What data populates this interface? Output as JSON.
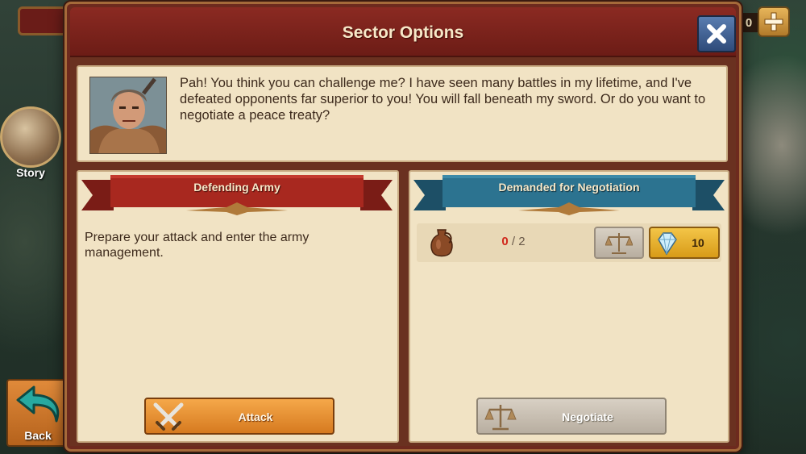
{
  "hud": {
    "coin_count": "0",
    "story_label": "Story",
    "back_label": "Back"
  },
  "modal": {
    "title": "Sector Options",
    "dialogue": "Pah! You think you can challenge me? I have seen many battles in my lifetime, and I've defeated opponents far superior to you! You will fall beneath my sword. Or do you want to negotiate a peace treaty?",
    "left_panel": {
      "title": "Defending Army",
      "description": "Prepare your attack and enter the army management.",
      "button_label": "Attack"
    },
    "right_panel": {
      "title": "Demanded for Negotiation",
      "resource": {
        "icon": "jug-icon",
        "have": "0",
        "need": "/ 2",
        "gem_cost": "10"
      },
      "button_label": "Negotiate"
    }
  },
  "colors": {
    "header_red": "#8b2a22",
    "parchment": "#f1e3c4",
    "ribbon_red": "#9e2a22",
    "ribbon_blue": "#2a6f8e",
    "attack_orange": "#e08a2a",
    "disabled_gray": "#c4bbae",
    "gem_gold": "#e6ae30"
  }
}
